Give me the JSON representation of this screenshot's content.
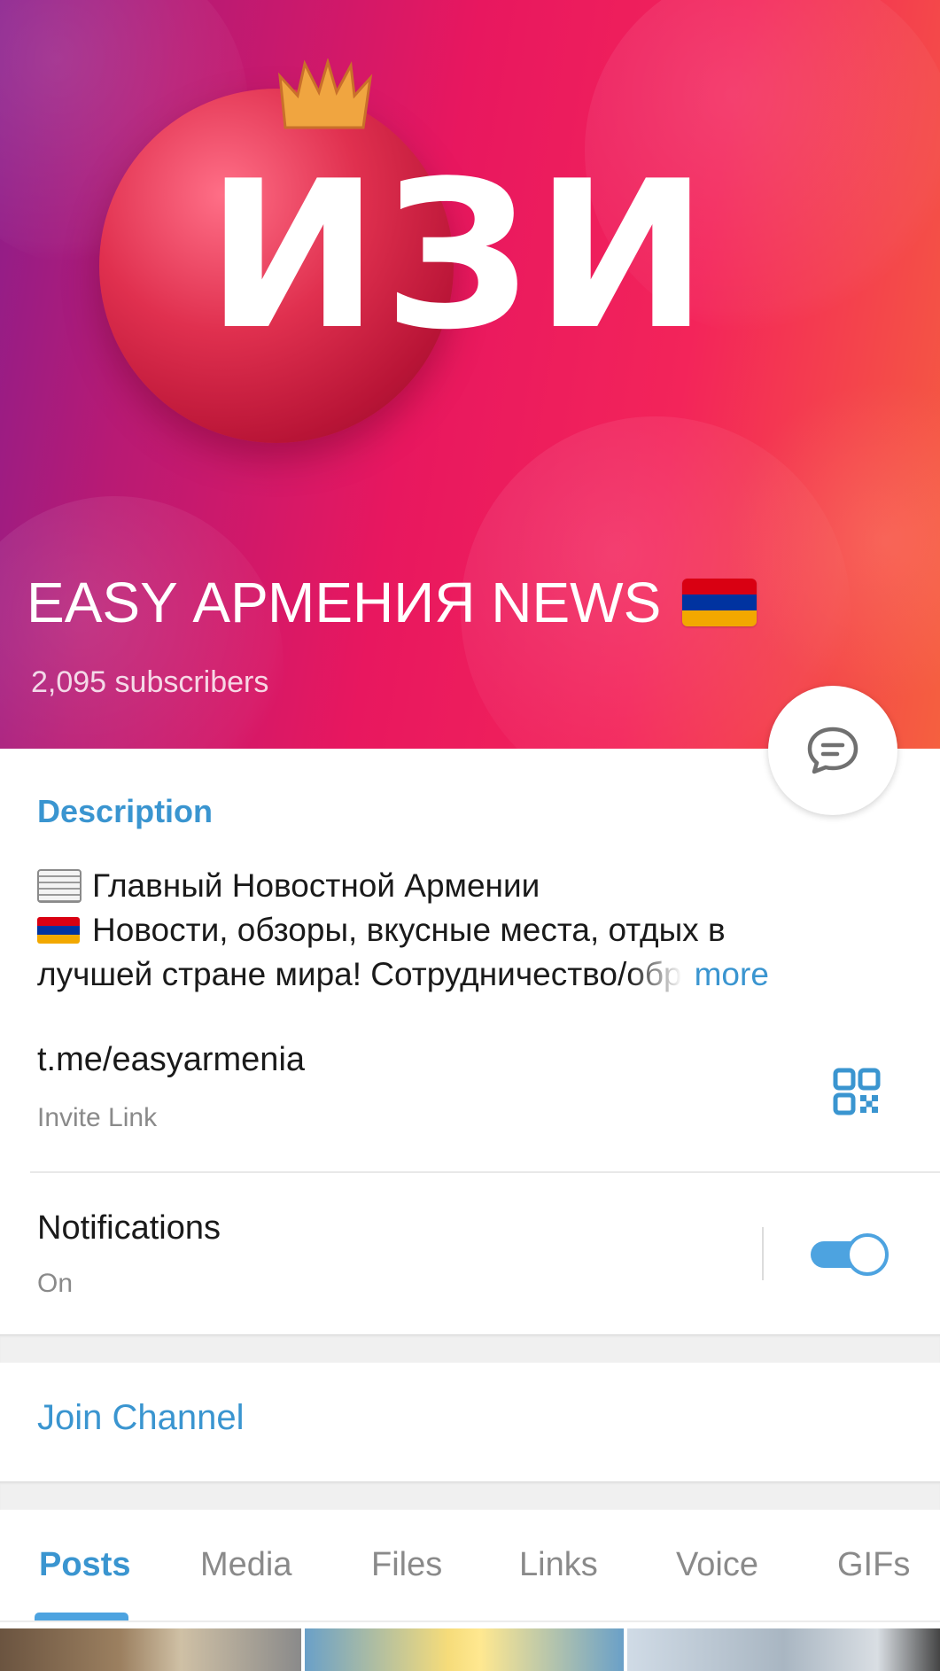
{
  "channel": {
    "cover_logo": "ИЗИ",
    "title": "EASY АРМЕНИЯ NEWS",
    "subscribers": "2,095 subscribers"
  },
  "description": {
    "label": "Description",
    "line1": "Главный Новостной Армении",
    "line2": "Новости, обзоры, вкусные места, отдых в",
    "line3": "лучшей стране мира!  Сотрудничество/обр",
    "more": "more"
  },
  "invite": {
    "link": "t.me/easyarmenia",
    "caption": "Invite Link",
    "icon": "qr-code-icon"
  },
  "notifications": {
    "title": "Notifications",
    "value": "On",
    "toggle_on": true
  },
  "join": {
    "label": "Join Channel"
  },
  "tabs": [
    {
      "label": "Posts",
      "active": true
    },
    {
      "label": "Media",
      "active": false
    },
    {
      "label": "Files",
      "active": false
    },
    {
      "label": "Links",
      "active": false
    },
    {
      "label": "Voice",
      "active": false
    },
    {
      "label": "GIFs",
      "active": false
    }
  ],
  "colors": {
    "accent": "#3a95d0",
    "toggle": "#4da3e0",
    "flag_red": "#d90012",
    "flag_blue": "#0033a0",
    "flag_orange": "#f2a800"
  }
}
